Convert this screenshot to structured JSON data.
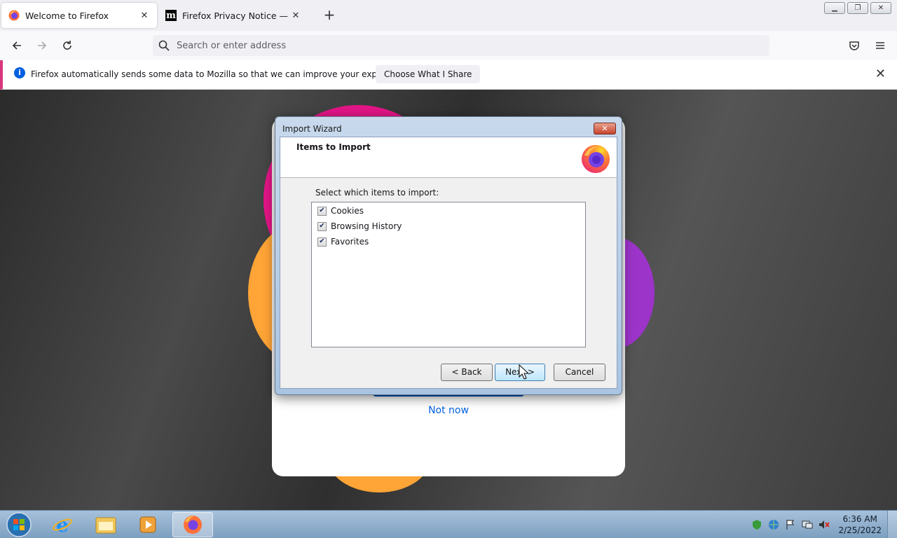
{
  "browser": {
    "tabs": [
      {
        "title": "Welcome to Firefox",
        "icon": "firefox-icon",
        "active": true
      },
      {
        "title": "Firefox Privacy Notice — Mozilla",
        "icon": "mozilla-m-icon",
        "active": false
      }
    ],
    "new_tab_label": "+",
    "tab_close_glyph": "✕",
    "window_controls": {
      "minimize": "▁",
      "restore": "❐",
      "close": "✕"
    },
    "address_placeholder": "Search or enter address"
  },
  "notification": {
    "message": "Firefox automatically sends some data to Mozilla so that we can improve your experience.",
    "button_label": "Choose What I Share",
    "info_glyph": "i",
    "close_glyph": "✕"
  },
  "welcome": {
    "secondary_link": "Not now"
  },
  "import_wizard": {
    "window_title": "Import Wizard",
    "close_glyph": "✕",
    "heading": "Items to Import",
    "prompt": "Select which items to import:",
    "items": [
      {
        "label": "Cookies",
        "checked": true
      },
      {
        "label": "Browsing History",
        "checked": true
      },
      {
        "label": "Favorites",
        "checked": true
      }
    ],
    "check_glyph": "✔",
    "buttons": {
      "back": "< Back",
      "next": "Next >",
      "cancel": "Cancel"
    }
  },
  "taskbar": {
    "apps": [
      "windows-start-icon",
      "internet-explorer-icon",
      "file-explorer-icon",
      "media-player-icon",
      "firefox-icon"
    ],
    "clock_time": "6:36 AM",
    "clock_date": "2/25/2022"
  },
  "colors": {
    "accent_blue": "#0060df",
    "notification_stripe": "#d7367c",
    "wizard_frame": "#a9c4e2"
  }
}
